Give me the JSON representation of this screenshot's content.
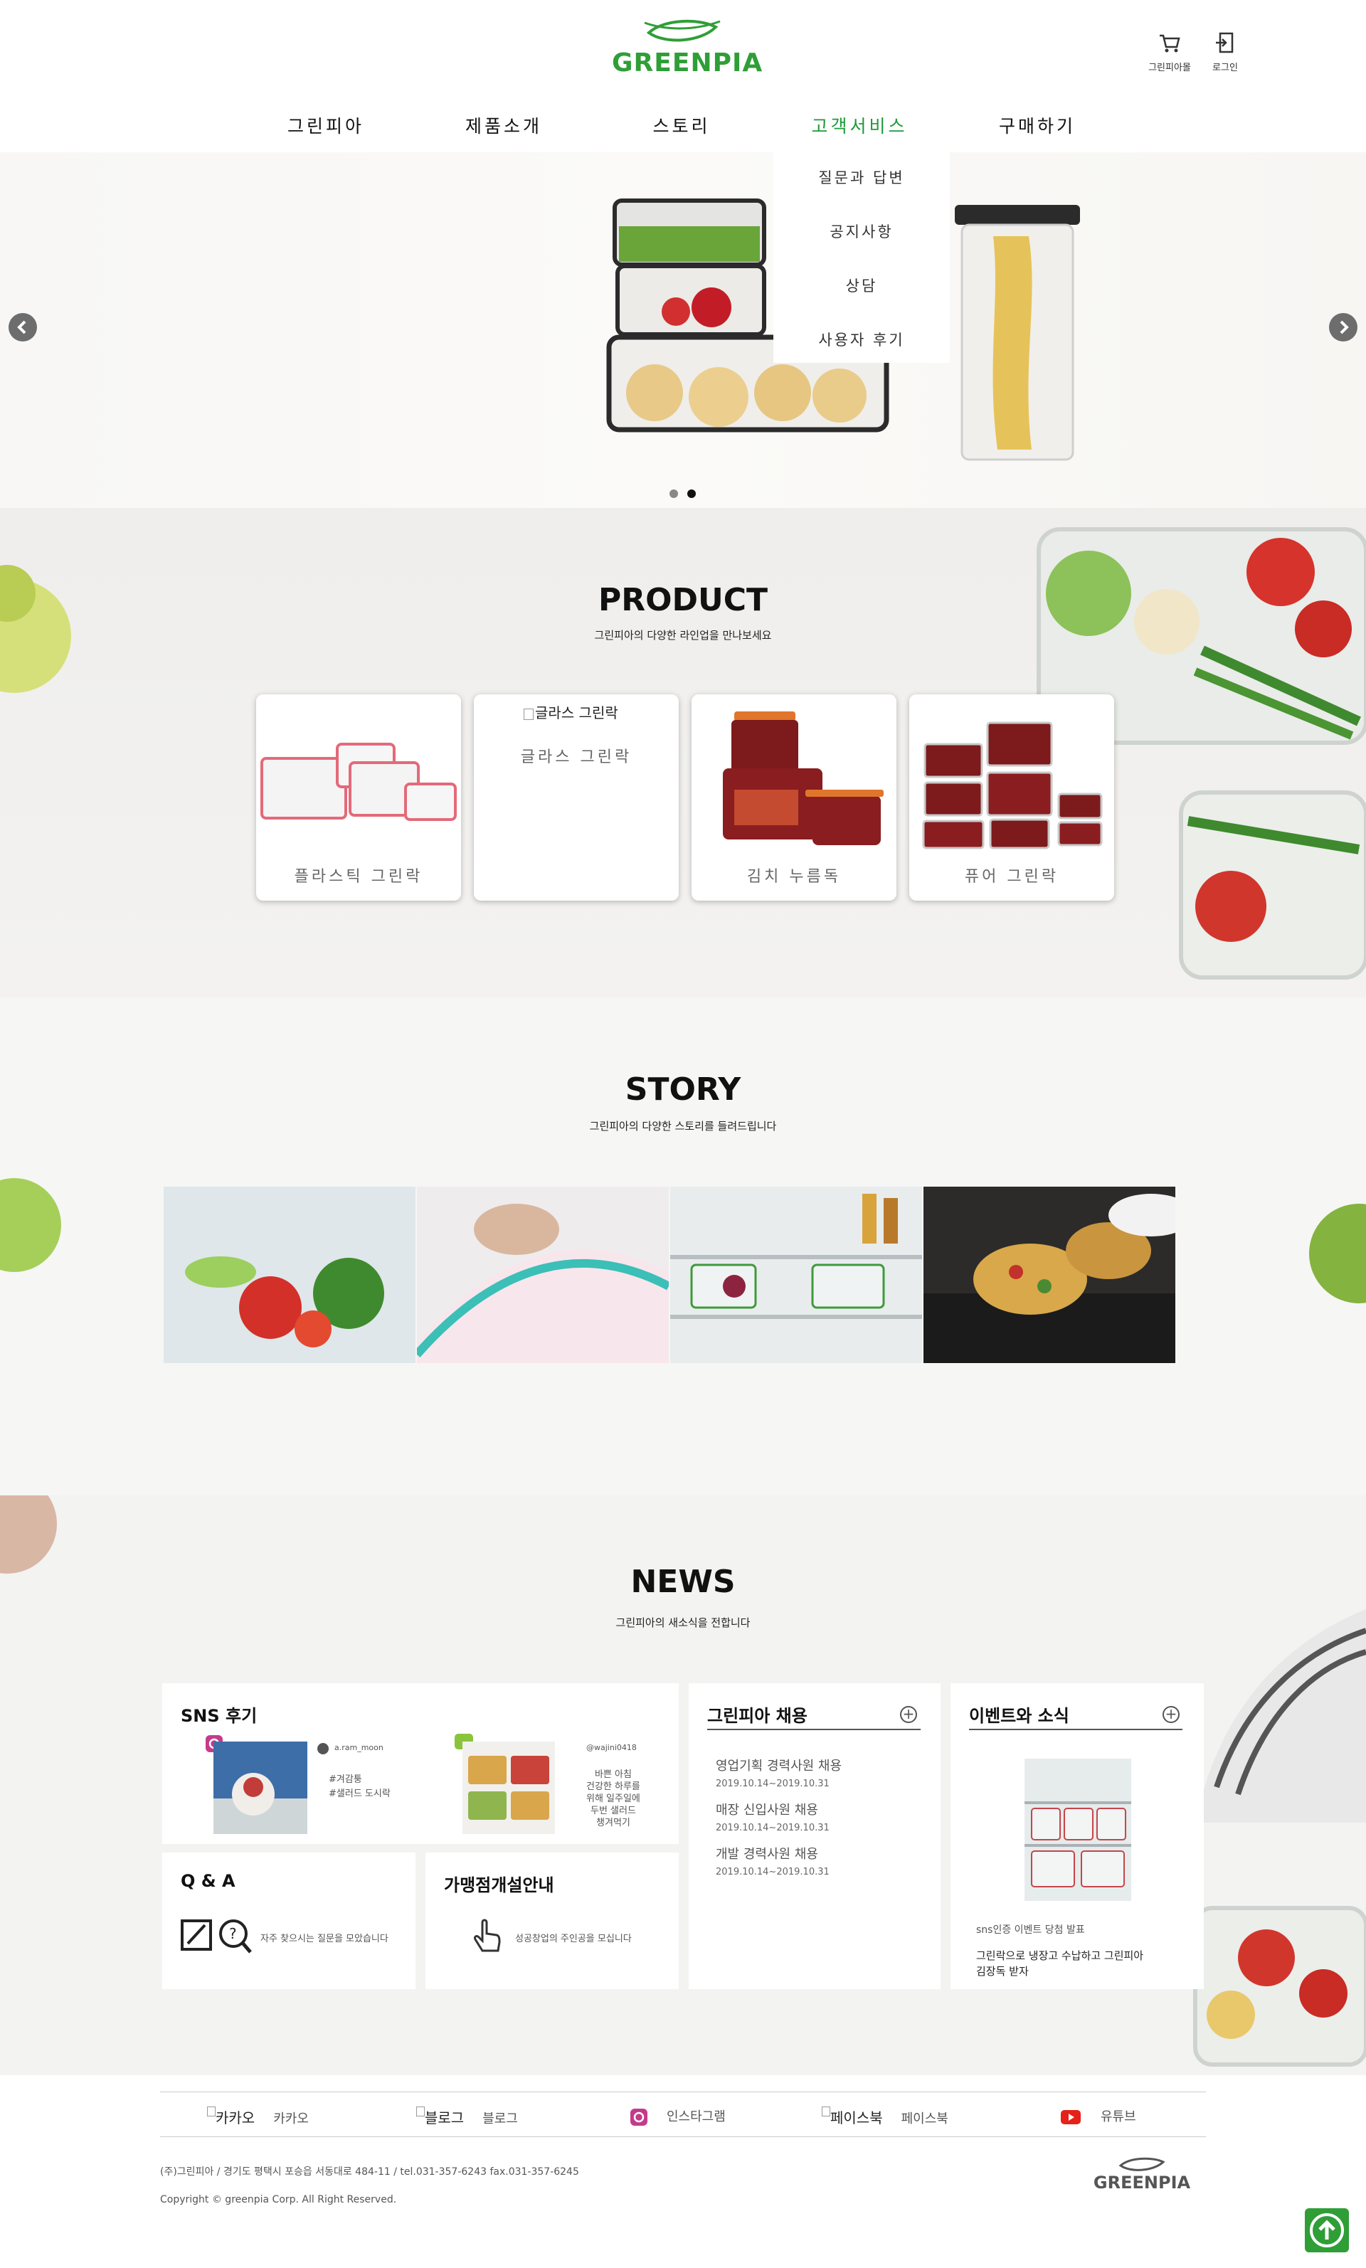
{
  "header": {
    "logo_text": "GREENPIA",
    "utility": [
      {
        "label": "그린피아몰",
        "icon": "cart-icon"
      },
      {
        "label": "로그인",
        "icon": "login-icon"
      }
    ]
  },
  "nav": {
    "items": [
      "그린피아",
      "제품소개",
      "스토리",
      "고객서비스",
      "구매하기"
    ],
    "active_index": 3,
    "dropdown": [
      "질문과 답변",
      "공지사항",
      "상담",
      "사용자 후기"
    ]
  },
  "hero": {
    "slide_count": 2,
    "active_slide": 2,
    "prev_icon": "chevron-left-icon",
    "next_icon": "chevron-right-icon"
  },
  "product": {
    "title": "PRODUCT",
    "subtitle": "그린피아의 다양한 라인업을 만나보세요",
    "cards": [
      {
        "label": "플라스틱 그린락"
      },
      {
        "label": "글라스 그린락",
        "broken_alt": "글라스 그린락"
      },
      {
        "label": "김치 누름독"
      },
      {
        "label": "퓨어 그린락"
      }
    ]
  },
  "story": {
    "title": "STORY",
    "subtitle": "그린피아의 다양한 스토리를 들려드립니다"
  },
  "news": {
    "title": "NEWS",
    "subtitle": "그린피아의 새소식을 전합니다",
    "sns": {
      "title": "SNS 후기",
      "posts": [
        {
          "user": "a.ram_moon",
          "text": "#겨감퉁\n#샐러드 도시락"
        },
        {
          "user": "@wajini0418",
          "text": "바쁜 아침\n건강한 하루를\n위해 일주일에\n두번 샐러드\n챙겨먹기"
        }
      ]
    },
    "qa": {
      "title": "Q & A",
      "text": "자주 찾으시는 질문을 모았습니다"
    },
    "franchise": {
      "title": "가맹점개설안내",
      "text": "성공창업의 주인공을 모십니다"
    },
    "recruit": {
      "title": "그린피아 채용",
      "items": [
        {
          "title": "영업기획 경력사원 채용",
          "date": "2019.10.14~2019.10.31"
        },
        {
          "title": "매장 신입사원 채용",
          "date": "2019.10.14~2019.10.31"
        },
        {
          "title": "개발 경력사원 채용",
          "date": "2019.10.14~2019.10.31"
        }
      ]
    },
    "events": {
      "title": "이벤트와 소식",
      "caption": "sns인증 이벤트 당첨 발표",
      "text": "그린락으로 냉장고 수납하고 그린피아\n김장독 받자"
    }
  },
  "footer": {
    "sns": [
      {
        "alt": "카카오",
        "label": "카카오"
      },
      {
        "alt": "블로그",
        "label": "블로그"
      },
      {
        "alt": "",
        "label": "인스타그램",
        "icon": "instagram-icon"
      },
      {
        "alt": "페이스북",
        "label": "페이스북"
      },
      {
        "alt": "",
        "label": "유튜브",
        "icon": "youtube-icon"
      }
    ],
    "address": "(주)그린피아 / 경기도 평택시 포승읍 서동대로 484-11 / tel.031-357-6243 fax.031-357-6245",
    "copyright": "Copyright © greenpia Corp. All Right Reserved.",
    "logo_text": "GREENPIA"
  },
  "colors": {
    "brand": "#2f9e37",
    "nav_active": "#1d9a3a"
  }
}
